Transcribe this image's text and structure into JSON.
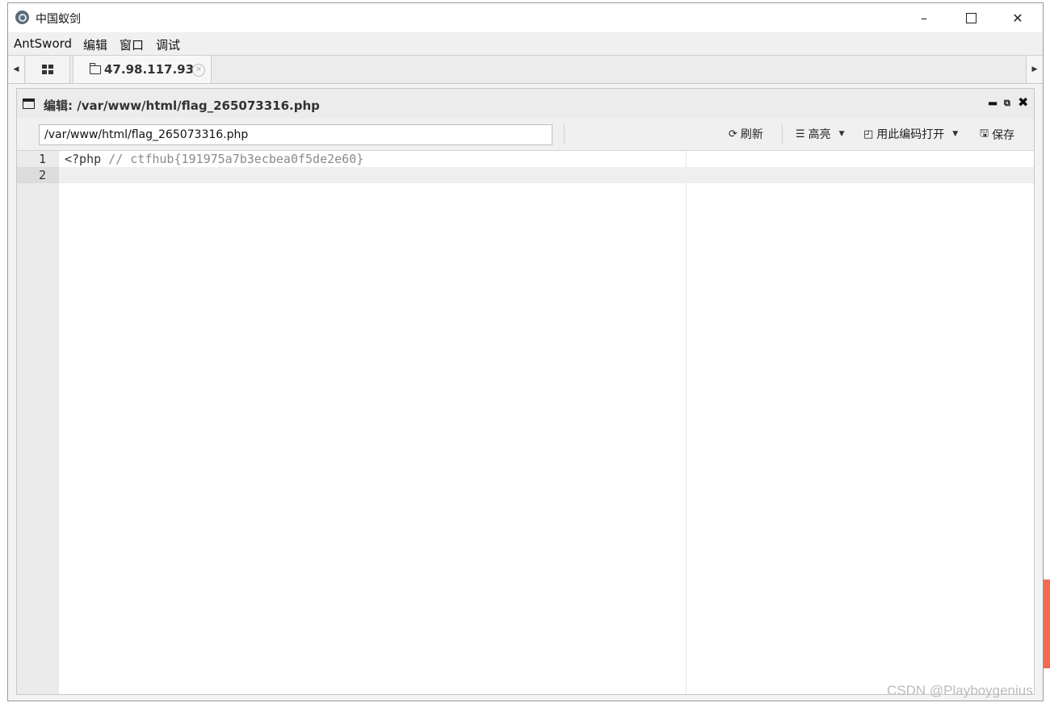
{
  "window": {
    "title": "中国蚁剑"
  },
  "menubar": {
    "items": [
      "AntSword",
      "编辑",
      "窗口",
      "调试"
    ]
  },
  "tabs": {
    "host": "47.98.117.93"
  },
  "panel": {
    "title": "编辑: /var/www/html/flag_265073316.php"
  },
  "toolbar": {
    "path_value": "/var/www/html/flag_265073316.php",
    "refresh": "刷新",
    "highlight": "高亮",
    "open_with_encoding": "用此编码打开",
    "save": "保存"
  },
  "editor": {
    "lines": [
      {
        "num": "1",
        "code": "<?php",
        "comment": " // ctfhub{191975a7b3ecbea0f5de2e60}"
      },
      {
        "num": "2",
        "code": "",
        "comment": ""
      }
    ]
  },
  "watermark": "CSDN @Playboygenius"
}
